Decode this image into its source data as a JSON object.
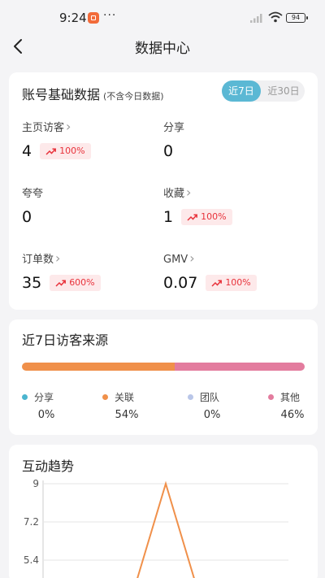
{
  "status_bar": {
    "time": "9:24",
    "dots": "···",
    "battery": "94"
  },
  "nav": {
    "title": "数据中心",
    "back_icon": "chevron-left-icon"
  },
  "account": {
    "title": "账号基础数据",
    "subtitle": "(不含今日数据)",
    "toggle": {
      "active": "近7日",
      "inactive": "近30日"
    },
    "metrics": [
      {
        "label": "主页访客",
        "has_chevron": true,
        "value": "4",
        "badge": "100%"
      },
      {
        "label": "分享",
        "has_chevron": false,
        "value": "0",
        "badge": null
      },
      {
        "label": "夸夸",
        "has_chevron": false,
        "value": "0",
        "badge": null
      },
      {
        "label": "收藏",
        "has_chevron": true,
        "value": "1",
        "badge": "100%"
      },
      {
        "label": "订单数",
        "has_chevron": true,
        "value": "35",
        "badge": "600%"
      },
      {
        "label": "GMV",
        "has_chevron": true,
        "value": "0.07",
        "badge": "100%"
      }
    ],
    "badge_color": "#e8323b",
    "badge_bg": "#fde9ea"
  },
  "visitor_sources": {
    "title": "近7日访客来源",
    "items": [
      {
        "label": "分享",
        "pct": "0%",
        "value": 0,
        "color": "#4bb5cf"
      },
      {
        "label": "关联",
        "pct": "54%",
        "value": 54,
        "color": "#f0904a"
      },
      {
        "label": "团队",
        "pct": "0%",
        "value": 0,
        "color": "#b9c6e8"
      },
      {
        "label": "其他",
        "pct": "46%",
        "value": 46,
        "color": "#e37c9e"
      }
    ]
  },
  "interaction_trend": {
    "title": "互动趋势",
    "chart_data": {
      "type": "line",
      "y_ticks": [
        "9",
        "7.2",
        "5.4"
      ],
      "ylim_visible": [
        5.4,
        9
      ],
      "series": [
        {
          "values_visible": [
            {
              "x": 0.36,
              "y": 3.6
            },
            {
              "x": 0.5,
              "y": 9
            },
            {
              "x": 0.64,
              "y": 3.6
            }
          ],
          "color": "#f0904a"
        }
      ]
    }
  }
}
